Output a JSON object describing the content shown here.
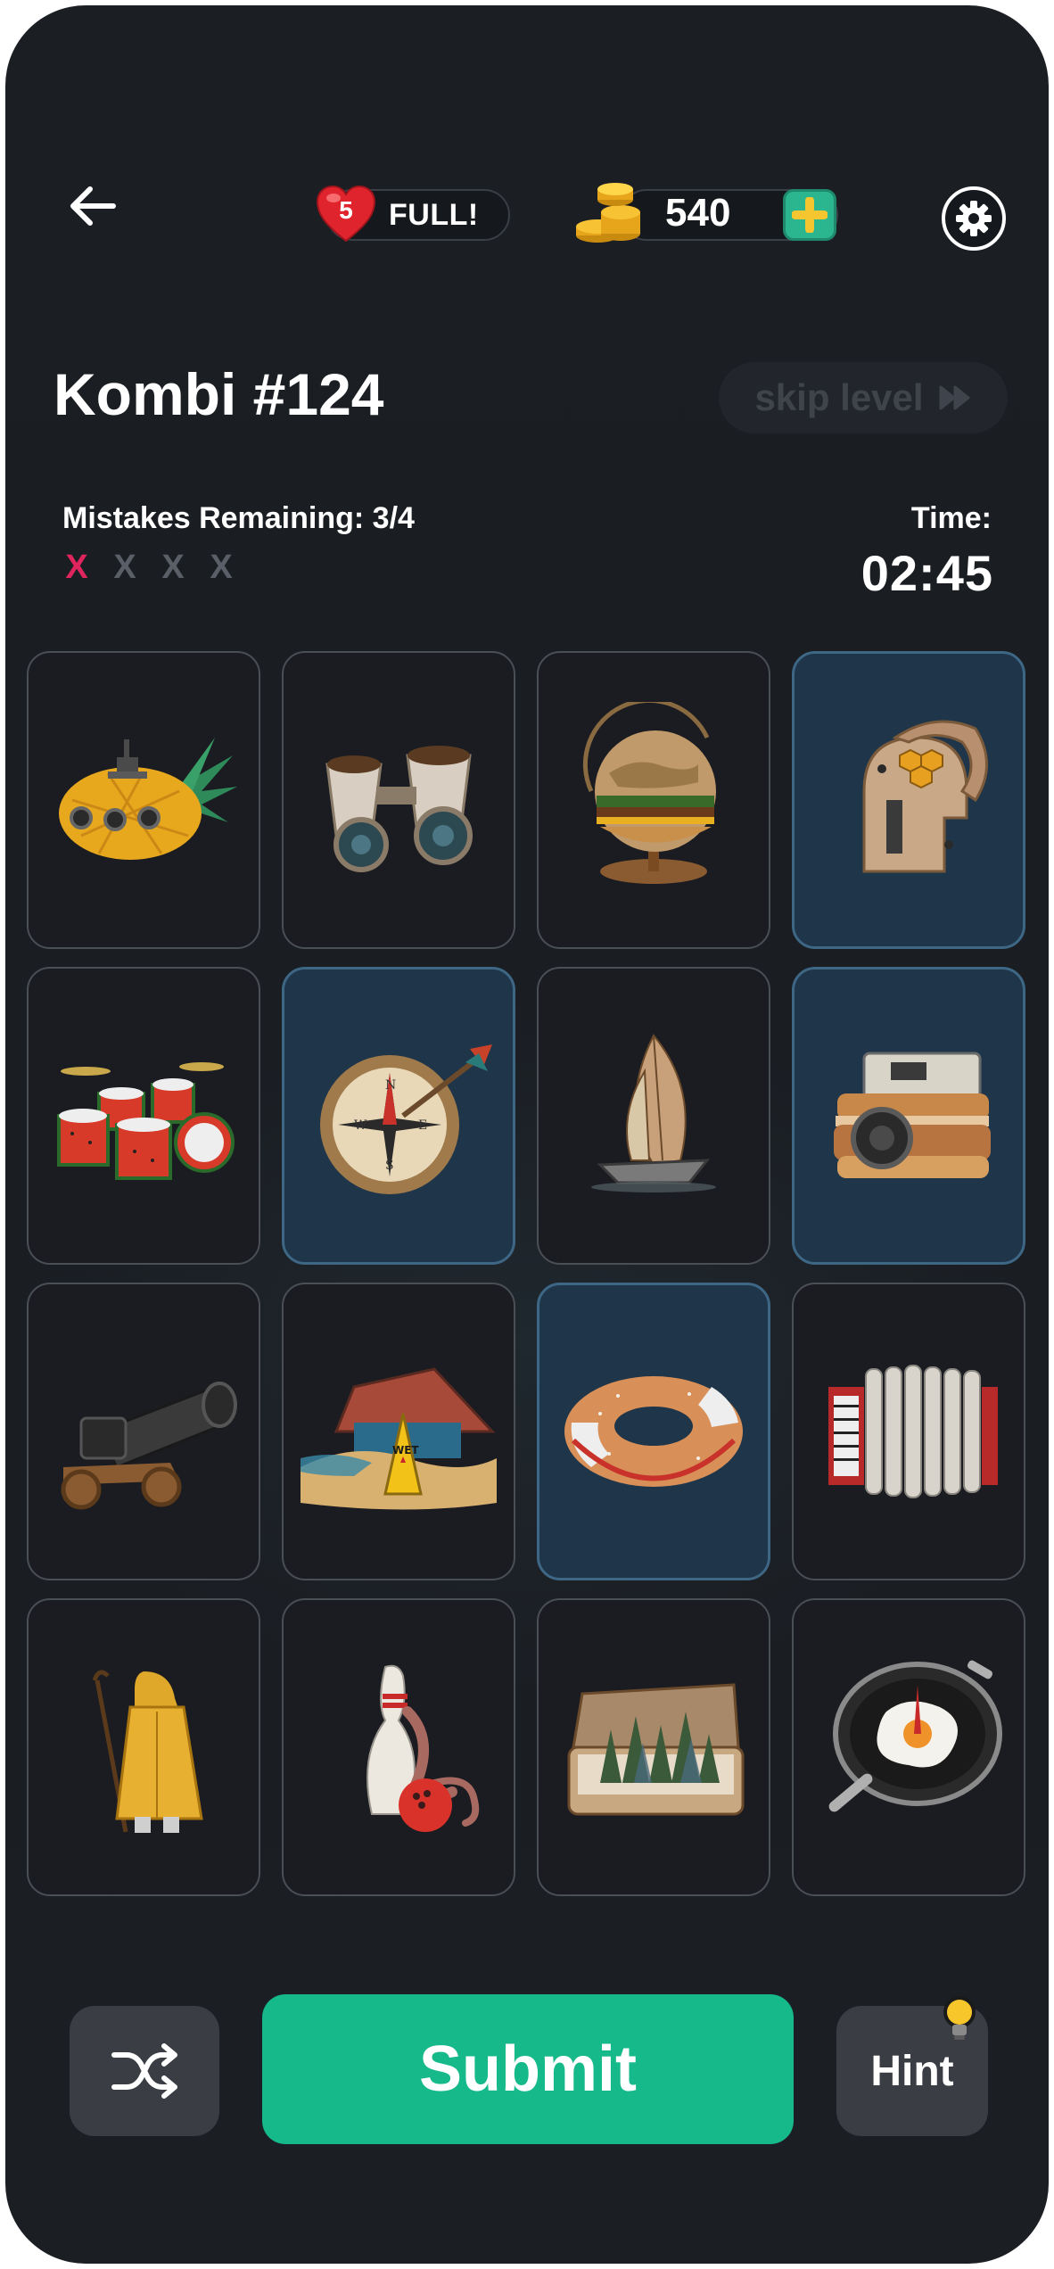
{
  "header": {
    "lives_count": "5",
    "lives_status": "FULL!",
    "coins": "540"
  },
  "puzzle": {
    "title": "Kombi #124",
    "skip_label": "skip level",
    "mistakes_label": "Mistakes Remaining: 3/4",
    "mistakes": [
      {
        "mark": "X",
        "used": true
      },
      {
        "mark": "X",
        "used": false
      },
      {
        "mark": "X",
        "used": false
      },
      {
        "mark": "X",
        "used": false
      }
    ],
    "time_label": "Time:",
    "time_value": "02:45"
  },
  "tiles": [
    {
      "icon": "pineapple-submarine-icon",
      "selected": false
    },
    {
      "icon": "coffee-cup-binoculars-icon",
      "selected": false
    },
    {
      "icon": "burger-globe-icon",
      "selected": false
    },
    {
      "icon": "beehive-helmet-icon",
      "selected": true
    },
    {
      "icon": "watermelon-drum-kit-icon",
      "selected": false
    },
    {
      "icon": "compass-dart-icon",
      "selected": true
    },
    {
      "icon": "leaf-sailboat-icon",
      "selected": false
    },
    {
      "icon": "sandwich-camera-icon",
      "selected": true
    },
    {
      "icon": "camera-cannon-icon",
      "selected": false
    },
    {
      "icon": "wet-floor-beach-icon",
      "selected": false
    },
    {
      "icon": "bagel-life-ring-icon",
      "selected": true
    },
    {
      "icon": "radiator-accordion-icon",
      "selected": false
    },
    {
      "icon": "raincoat-shepherd-icon",
      "selected": false
    },
    {
      "icon": "octopus-bowling-pin-icon",
      "selected": false
    },
    {
      "icon": "suitcase-forest-icon",
      "selected": false
    },
    {
      "icon": "egg-compass-pan-icon",
      "selected": false
    }
  ],
  "controls": {
    "submit_label": "Submit",
    "hint_label": "Hint"
  },
  "colors": {
    "background": "#1b1e23",
    "tile": "#1a1c21",
    "tile_selected": "#1f3549",
    "submit": "#16b98a",
    "mistake_used": "#e0245e",
    "mistake_unused": "#5a5e66"
  }
}
